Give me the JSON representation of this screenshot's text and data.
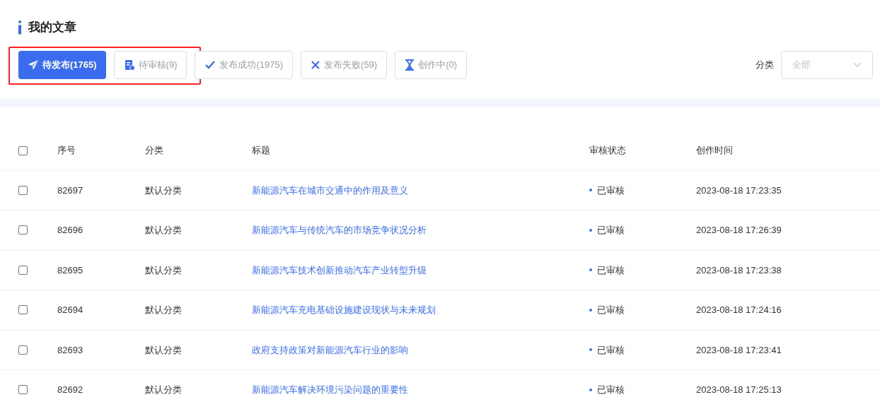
{
  "title": "我的文章",
  "tabs": [
    {
      "kind": "send",
      "label": "待发布(1765)",
      "selected": true
    },
    {
      "kind": "review",
      "label": "待审核(9)",
      "selected": false
    },
    {
      "kind": "check",
      "label": "发布成功(1975)",
      "selected": false
    },
    {
      "kind": "cross",
      "label": "发布失败(59)",
      "selected": false
    },
    {
      "kind": "hourglass",
      "label": "创作中(0)",
      "selected": false
    }
  ],
  "filter": {
    "label": "分类",
    "placeholder": "全部"
  },
  "table": {
    "all_checked": false,
    "columns": [
      "序号",
      "分类",
      "标题",
      "审核状态",
      "创作时间"
    ],
    "rows": [
      {
        "checked": false,
        "id": "82697",
        "category": "默认分类",
        "title": "新能源汽车在城市交通中的作用及意义",
        "status": "已审核",
        "time": "2023-08-18 17:23:35"
      },
      {
        "checked": false,
        "id": "82696",
        "category": "默认分类",
        "title": "新能源汽车与传统汽车的市场竞争状况分析",
        "status": "已审核",
        "time": "2023-08-18 17:26:39"
      },
      {
        "checked": false,
        "id": "82695",
        "category": "默认分类",
        "title": "新能源汽车技术创新推动汽车产业转型升级",
        "status": "已审核",
        "time": "2023-08-18 17:23:38"
      },
      {
        "checked": false,
        "id": "82694",
        "category": "默认分类",
        "title": "新能源汽车充电基础设施建设现状与未来规划",
        "status": "已审核",
        "time": "2023-08-18 17:24:16"
      },
      {
        "checked": false,
        "id": "82693",
        "category": "默认分类",
        "title": "政府支持政策对新能源汽车行业的影响",
        "status": "已审核",
        "time": "2023-08-18 17:23:41"
      },
      {
        "checked": false,
        "id": "82692",
        "category": "默认分类",
        "title": "新能源汽车解决环境污染问题的重要性",
        "status": "已审核",
        "time": "2023-08-18 17:25:13"
      }
    ]
  }
}
